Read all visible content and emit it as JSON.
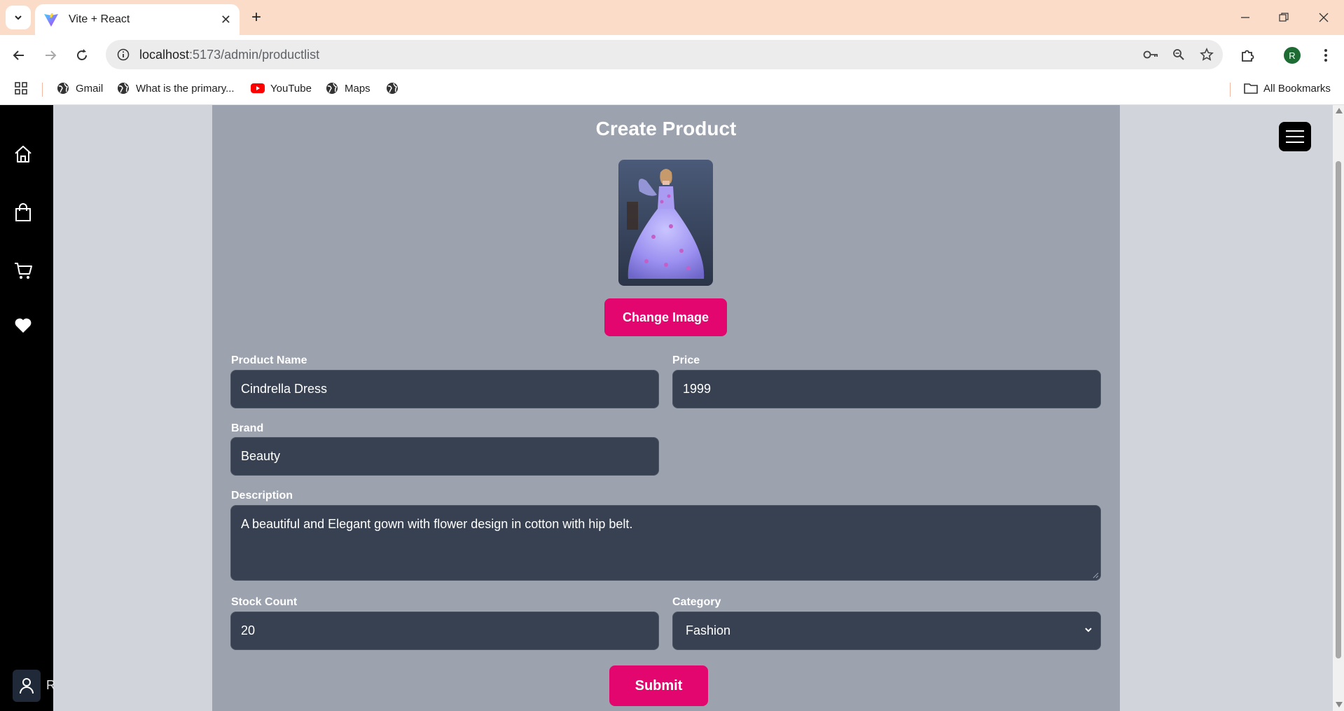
{
  "browser": {
    "tab_title": "Vite + React",
    "url_host": "localhost",
    "url_path": ":5173/admin/productlist",
    "bookmarks": [
      {
        "label": "Gmail",
        "icon": "globe-icon"
      },
      {
        "label": "What is the primary...",
        "icon": "globe-icon"
      },
      {
        "label": "YouTube",
        "icon": "youtube-icon"
      },
      {
        "label": "Maps",
        "icon": "globe-icon"
      },
      {
        "label": "",
        "icon": "globe-icon"
      }
    ],
    "all_bookmarks": "All Bookmarks",
    "profile_initial": "R"
  },
  "sidebar": {
    "items": [
      {
        "icon": "home-icon"
      },
      {
        "icon": "shopping-bag-icon"
      },
      {
        "icon": "cart-icon"
      },
      {
        "icon": "heart-icon"
      }
    ],
    "user_initial": "R"
  },
  "form": {
    "title": "Create Product",
    "change_image_label": "Change Image",
    "product_name_label": "Product Name",
    "product_name_value": "Cindrella Dress",
    "price_label": "Price",
    "price_value": "1999",
    "brand_label": "Brand",
    "brand_value": "Beauty",
    "description_label": "Description",
    "description_value": "A beautiful and Elegant gown with flower design in cotton with hip belt.",
    "stock_label": "Stock Count",
    "stock_value": "20",
    "category_label": "Category",
    "category_value": "Fashion",
    "submit_label": "Submit"
  },
  "colors": {
    "accent": "#e3066e",
    "panel": "#9ca3af",
    "field": "#374151",
    "sidebar": "#000000"
  }
}
